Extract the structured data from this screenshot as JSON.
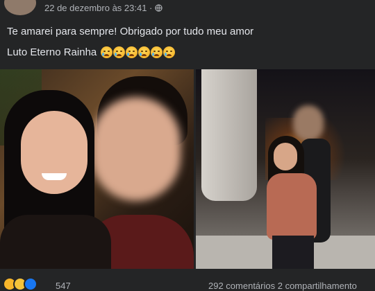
{
  "post": {
    "timestamp": "22 de dezembro às 23:41 ·",
    "privacy_icon": "globe-icon",
    "text_line1": "Te amarei para sempre! Obrigado por tudo meu amor",
    "text_line2": "Luto Eterno Rainha",
    "emoji_count": 6,
    "emoji_icon": "crying-face-icon"
  },
  "footer": {
    "reactions": [
      "haha-icon",
      "sad-icon",
      "like-icon"
    ],
    "reaction_count": "547",
    "comments_shares": "292 comentários 2 compartilhamento"
  },
  "colors": {
    "background": "#242526",
    "text": "#e4e6eb",
    "secondary_text": "#b0b3b8"
  }
}
